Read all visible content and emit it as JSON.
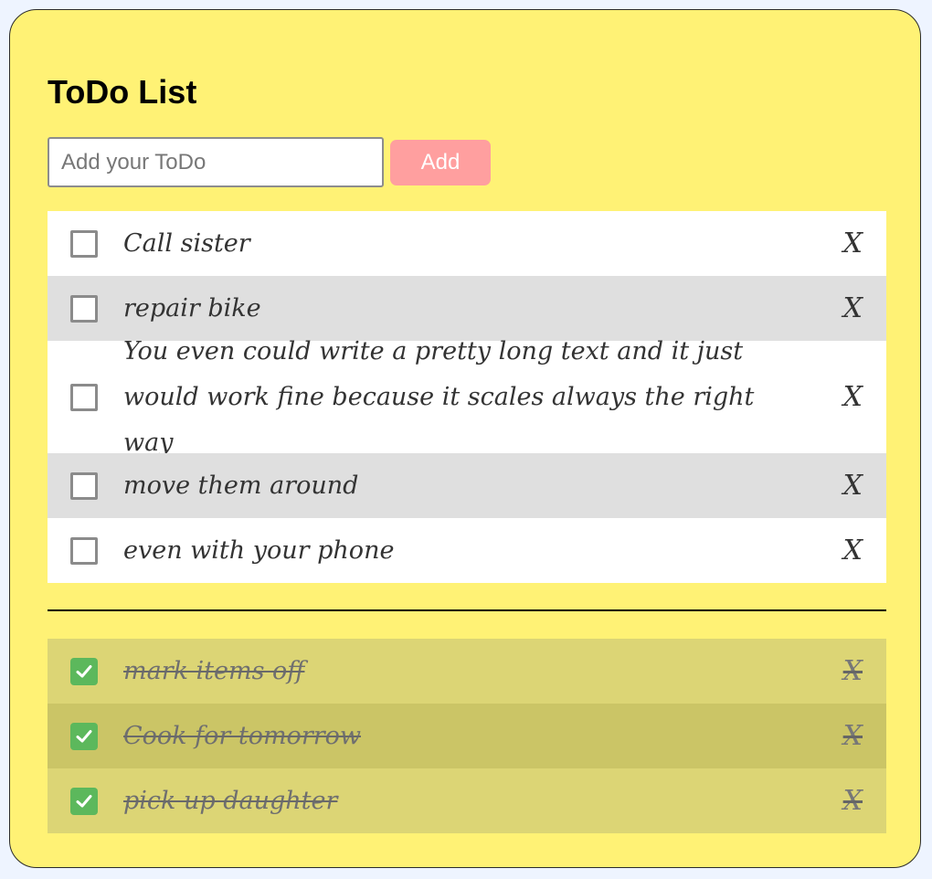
{
  "app": {
    "title": "ToDo List"
  },
  "input": {
    "placeholder": "Add your ToDo",
    "value": ""
  },
  "add_button": {
    "label": "Add"
  },
  "open_items": [
    {
      "text": "Call sister",
      "checked": false,
      "delete_label": "X"
    },
    {
      "text": "repair bike",
      "checked": false,
      "delete_label": "X"
    },
    {
      "text": "You even could write a pretty long text and it just would work fine because it scales always the right way",
      "checked": false,
      "delete_label": "X"
    },
    {
      "text": "move them around",
      "checked": false,
      "delete_label": "X"
    },
    {
      "text": "even with your phone",
      "checked": false,
      "delete_label": "X"
    }
  ],
  "done_items": [
    {
      "text": "mark items off",
      "checked": true,
      "delete_label": "X"
    },
    {
      "text": "Cook for tomorrow",
      "checked": true,
      "delete_label": "X"
    },
    {
      "text": "pick up daughter",
      "checked": true,
      "delete_label": "X"
    }
  ],
  "icons": {
    "checkbox_empty": "checkbox-empty-icon",
    "checkbox_checked": "checkmark-icon"
  },
  "colors": {
    "background": "#fff275",
    "add_button": "#ff9f9f",
    "checked": "#5cb85c",
    "open_row_light": "#ffffff",
    "open_row_dark": "#dfdfdf",
    "done_row_light": "#dcd575",
    "done_row_dark": "#cbc566"
  }
}
